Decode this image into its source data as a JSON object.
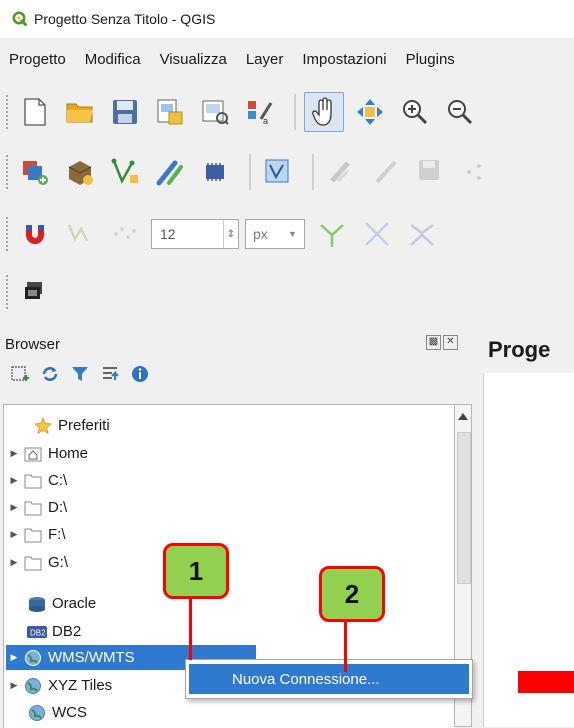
{
  "window": {
    "title": "Progetto Senza Titolo - QGIS"
  },
  "menubar": {
    "items": [
      "Progetto",
      "Modifica",
      "Visualizza",
      "Layer",
      "Impostazioni",
      "Plugins"
    ]
  },
  "toolbar3": {
    "size_value": "12",
    "unit_value": "px"
  },
  "browser": {
    "title": "Browser",
    "tree": [
      {
        "label": "Preferiti",
        "icon": "star-icon"
      },
      {
        "label": "Home",
        "icon": "home-folder-icon"
      },
      {
        "label": "C:\\",
        "icon": "folder-icon"
      },
      {
        "label": "D:\\",
        "icon": "folder-icon"
      },
      {
        "label": "F:\\",
        "icon": "folder-icon"
      },
      {
        "label": "G:\\",
        "icon": "folder-icon"
      },
      {
        "label": "Oracle",
        "icon": "oracle-db-icon"
      },
      {
        "label": "DB2",
        "icon": "db2-icon"
      },
      {
        "label": "WMS/WMTS",
        "icon": "globe-icon",
        "selected": true
      },
      {
        "label": "XYZ Tiles",
        "icon": "globe-icon"
      },
      {
        "label": "WCS",
        "icon": "globe-icon"
      }
    ]
  },
  "map_panel": {
    "title": "Proge"
  },
  "context_menu": {
    "item": "Nuova Connessione..."
  },
  "callouts": {
    "one": "1",
    "two": "2"
  },
  "colors": {
    "selection": "#2f79d1",
    "callout_fill": "#92d050",
    "callout_border": "#ff0000",
    "arrow": "#ff0000"
  }
}
